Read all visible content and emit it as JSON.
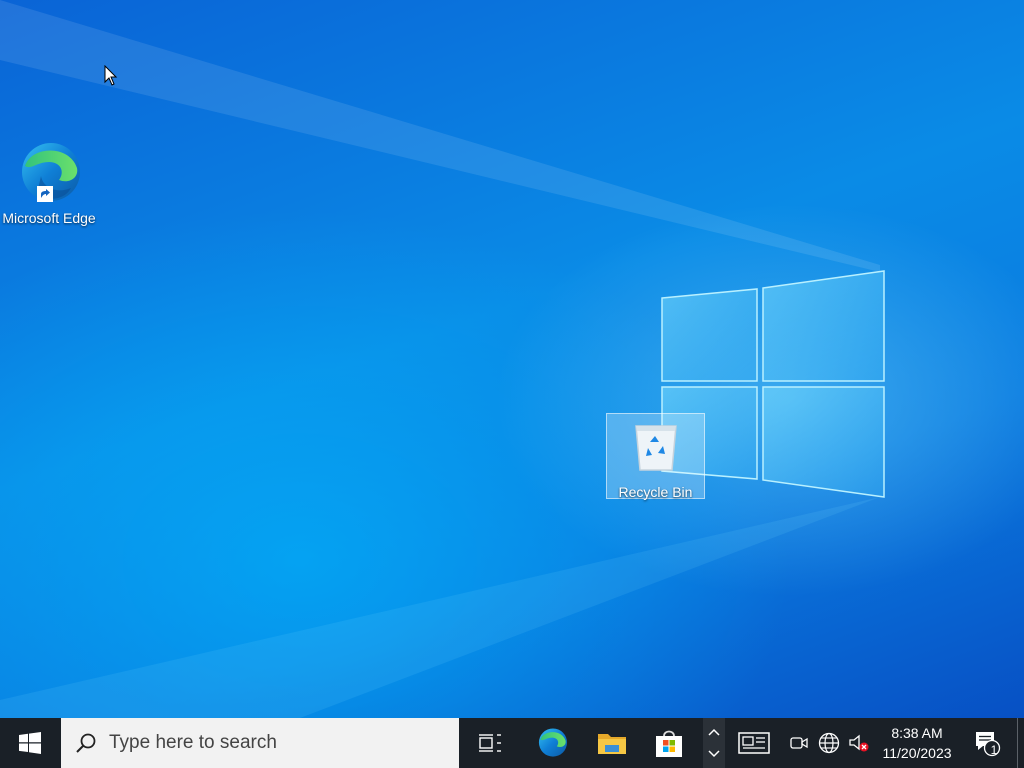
{
  "desktop": {
    "icons": [
      {
        "label": "Microsoft Edge",
        "icon": "edge-icon"
      },
      {
        "label": "Recycle Bin",
        "icon": "recycle-bin-icon",
        "selected": true
      }
    ],
    "background_colors": {
      "top": "#0a64d6",
      "center": "#0a8be6",
      "bottom": "#0750c4"
    }
  },
  "taskbar": {
    "background": "#1a2027",
    "search_placeholder": "Type here to search",
    "pinned": [
      {
        "name": "task-view",
        "icon": "task-view-icon"
      },
      {
        "name": "edge",
        "icon": "edge-icon"
      },
      {
        "name": "file-explorer",
        "icon": "folder-icon"
      },
      {
        "name": "microsoft-store",
        "icon": "store-icon"
      }
    ],
    "tray": {
      "icons": [
        "chevron-up-icon",
        "news-icon",
        "meet-now-icon",
        "network-globe-icon",
        "volume-muted-icon"
      ],
      "time": "8:38 AM",
      "date": "11/20/2023",
      "notification_count": "1"
    }
  }
}
